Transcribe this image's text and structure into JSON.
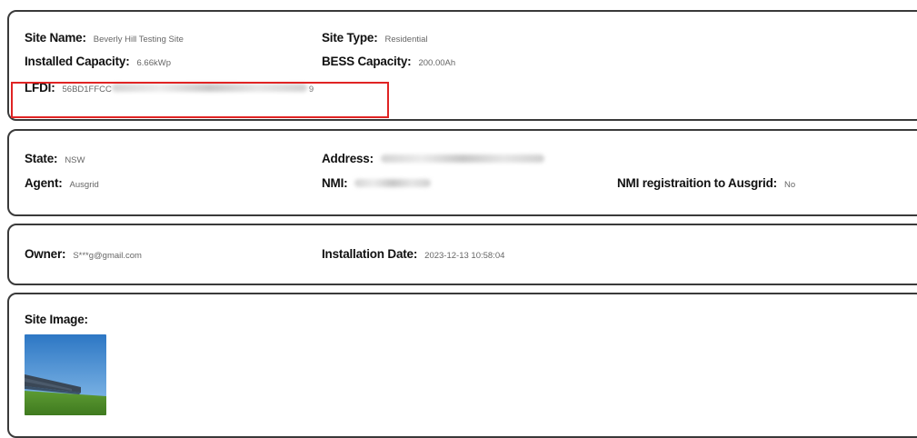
{
  "site": {
    "name_label": "Site Name:",
    "name_value": "Beverly Hill Testing Site",
    "type_label": "Site Type:",
    "type_value": "Residential",
    "installed_capacity_label": "Installed Capacity:",
    "installed_capacity_value": "6.66kWp",
    "bess_capacity_label": "BESS Capacity:",
    "bess_capacity_value": "200.00Ah",
    "lfdi_label": "LFDI:",
    "lfdi_value_visible": "56BD1FFCC",
    "lfdi_value_tail": "9"
  },
  "location": {
    "state_label": "State:",
    "state_value": "NSW",
    "address_label": "Address:",
    "agent_label": "Agent:",
    "agent_value": "Ausgrid",
    "nmi_label": "NMI:",
    "nmi_registration_label": "NMI registraition to Ausgrid:",
    "nmi_registration_value": "No"
  },
  "ownership": {
    "owner_label": "Owner:",
    "owner_value": "S***g@gmail.com",
    "installation_date_label": "Installation Date:",
    "installation_date_value": "2023-12-13 10:58:04"
  },
  "image_section": {
    "label": "Site Image:",
    "image_icon": "solar-panel-field-photo"
  },
  "colors": {
    "highlight_border": "#e02424",
    "card_border": "#3a3a3a"
  }
}
